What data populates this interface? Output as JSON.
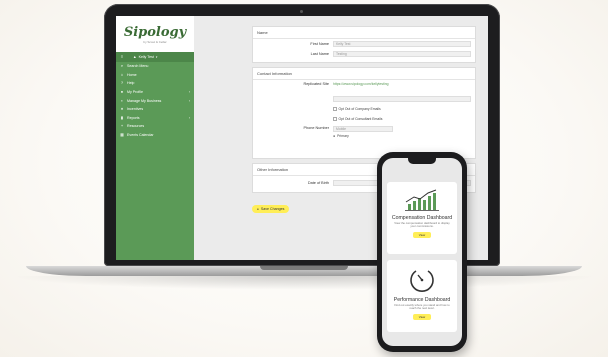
{
  "brand": {
    "name": "Sipology",
    "tagline": "by Scout & Cellar",
    "accent": "#5b9a57",
    "highlight": "#ffee57"
  },
  "sidebar": {
    "user_label": "Kelly Test",
    "items": [
      {
        "label": "Search Menu",
        "icon": "search-icon"
      },
      {
        "label": "Home",
        "icon": "home-icon"
      },
      {
        "label": "Help",
        "icon": "help-icon"
      },
      {
        "label": "My Profile",
        "icon": "user-icon"
      },
      {
        "label": "Manage My Business",
        "icon": "briefcase-icon"
      },
      {
        "label": "Incentives",
        "icon": "trophy-icon"
      },
      {
        "label": "Reports",
        "icon": "chart-icon"
      },
      {
        "label": "Resources",
        "icon": "plus-icon"
      },
      {
        "label": "Events Calendar",
        "icon": "calendar-icon"
      }
    ]
  },
  "form": {
    "name_section": "Name",
    "first_name_label": "First Name",
    "first_name_value": "Kelly Test",
    "last_name_label": "Last Name",
    "last_name_value": "Testing",
    "contact_section": "Contact Information",
    "replicated_site_label": "Replicated Site",
    "replicated_site_url": "https://www.sipology.com/kellytesting",
    "copy_button": "Copy Replicated Site",
    "qr_button": "Print QR Code",
    "opt_out_company": "Opt Out of Company Emails",
    "opt_out_consultant": "Opt Out of Consultant Emails",
    "phone_label": "Phone Number",
    "phone_type": "Mobile",
    "phone_primary": "Primary",
    "other_section": "Other Information",
    "dob_label": "Date of Birth",
    "save_button": "Save Changes"
  },
  "phone": {
    "cards": [
      {
        "title": "Compensation Dashboard",
        "desc": "View the compensation dashboard to display your commissions.",
        "button": "View"
      },
      {
        "title": "Performance Dashboard",
        "desc": "Find out exactly where you stand and how to reach the next level.",
        "button": "View"
      }
    ]
  }
}
